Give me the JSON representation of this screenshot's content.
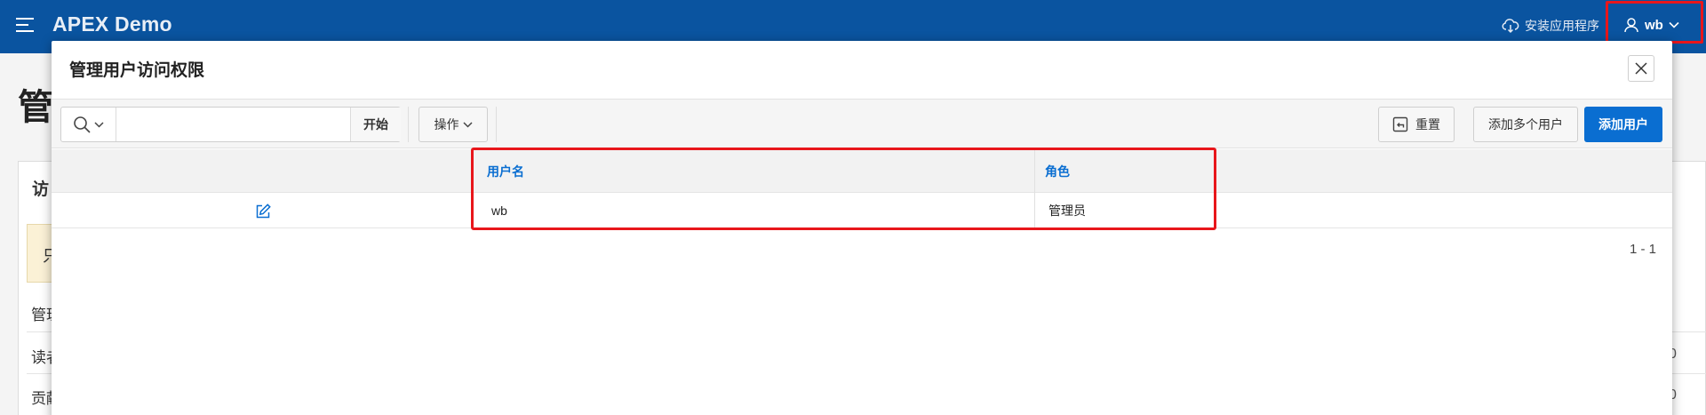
{
  "header": {
    "app_title": "APEX Demo",
    "install_app": "安装应用程序",
    "user": "wb"
  },
  "background_page": {
    "title": "管",
    "region_title": "访",
    "alert_text": "只",
    "lines": [
      "管理",
      "读者",
      "贡献"
    ],
    "zero": "0"
  },
  "dialog": {
    "title": "管理用户访问权限",
    "toolbar": {
      "search_placeholder": "",
      "go_label": "开始",
      "actions_label": "操作",
      "reset_label": "重置",
      "add_multiple_label": "添加多个用户",
      "add_user_label": "添加用户"
    },
    "columns": [
      "用户名",
      "角色"
    ],
    "rows": [
      {
        "username": "wb",
        "role": "管理员"
      }
    ],
    "pagination": "1 - 1"
  },
  "colors": {
    "header_bg": "#0a54a0",
    "primary": "#0a6ed1",
    "highlight": "#e8161b"
  }
}
